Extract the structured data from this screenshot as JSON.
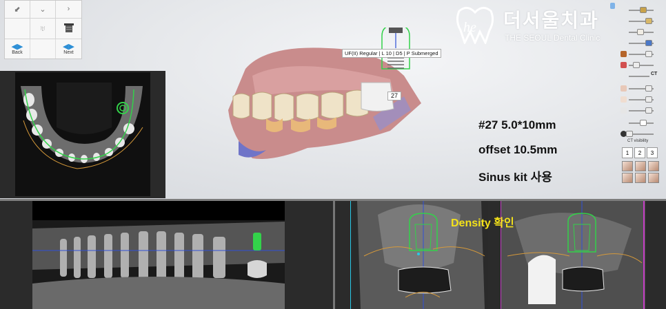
{
  "toolbox": {
    "back_label": "Back",
    "next_label": "Next"
  },
  "logo": {
    "korean": "더서울치과",
    "english": "THE SEOUL Dental Clinic"
  },
  "implant": {
    "label": "UF(II) Regular | L 10 | D5 | P Submerged",
    "tooth_number": "27"
  },
  "annotations": {
    "line1": "#27 5.0*10mm",
    "line2": "offset 10.5mm",
    "line3": "Sinus kit 사용"
  },
  "controls": {
    "ct_label": "CT",
    "ct_visibility": "CT visibility",
    "tabs": [
      "1",
      "2",
      "3"
    ]
  },
  "cross_section": {
    "density_label": "Density 확인"
  },
  "colors": {
    "accent_blue": "#2d8fd6",
    "implant_green": "#33d24a",
    "density_yellow": "#f4e21a",
    "nerve_orange": "#d79a3a"
  }
}
